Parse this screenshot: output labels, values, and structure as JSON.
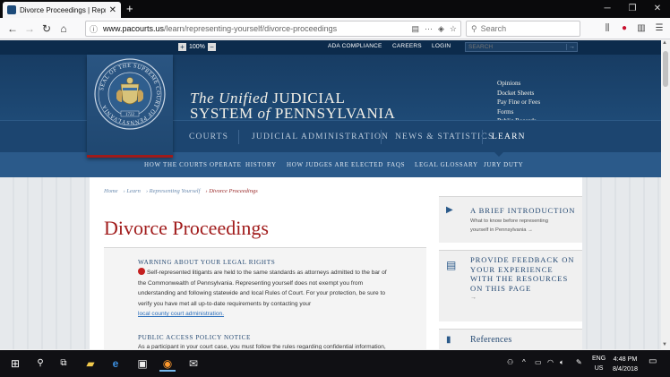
{
  "browser": {
    "tab_title": "Divorce Proceedings | Represe",
    "new_tab": "+",
    "url_prefix": "www.pacourts.us",
    "url_path": "/learn/representing-yourself/divorce-proceedings",
    "search_placeholder": "Search",
    "url_more": "···"
  },
  "top_strip": {
    "zoom_level": "100%",
    "zoom_plus": "+",
    "zoom_minus": "−",
    "links": [
      "ADA COMPLIANCE",
      "CAREERS",
      "LOGIN"
    ],
    "search_placeholder": "SEARCH",
    "search_go": "→"
  },
  "header": {
    "title_line1_italic": "The Unified",
    "title_line1_rest": "JUDICIAL",
    "title_line2_a": "SYSTEM",
    "title_line2_of": "of",
    "title_line2_b": "PENNSYLVANIA",
    "seal_text": "SEAL OF THE SUPREME COURT OF PENNSYLVANIA",
    "seal_year": "1722",
    "quick_links": [
      "Opinions",
      "Docket Sheets",
      "Pay Fine or Fees",
      "Forms",
      "Public Records"
    ]
  },
  "main_nav": [
    "COURTS",
    "JUDICIAL ADMINISTRATION",
    "NEWS & STATISTICS",
    "LEARN"
  ],
  "sub_nav": [
    "HOW THE COURTS OPERATE",
    "HISTORY",
    "HOW JUDGES ARE ELECTED",
    "FAQS",
    "LEGAL GLOSSARY",
    "JURY DUTY"
  ],
  "breadcrumb": [
    "Home",
    "› Learn",
    "› Representing Yourself",
    "› Divorce Proceedings"
  ],
  "page_title": "Divorce Proceedings",
  "sections": {
    "warning_heading": "WARNING ABOUT YOUR LEGAL RIGHTS",
    "warning_lines": [
      "Self-represented litigants are held to the same standards as attorneys admitted to the bar of",
      "the Commonwealth of Pennsylvania. Representing yourself does not exempt you from",
      "understanding and following statewide and local Rules of Court. For your protection, be sure to",
      "verify you have met all up-to-date requirements by contacting your"
    ],
    "warning_link": "local county court administration.",
    "policy_heading": "PUBLIC ACCESS POLICY NOTICE",
    "policy_line": "As a participant in your court case, you must follow the rules regarding confidential information,"
  },
  "sidebar": {
    "card1_title": "A BRIEF INTRODUCTION",
    "card1_desc_1": "What to know before representing",
    "card1_desc_2": "yourself in Pennsylvania →",
    "card2_title": [
      "PROVIDE FEEDBACK ON",
      "YOUR EXPERIENCE",
      "WITH THE RESOURCES",
      "ON THIS PAGE"
    ],
    "card2_arrow": "→",
    "card3_title": "References"
  },
  "taskbar": {
    "lang_1": "ENG",
    "lang_2": "US",
    "time": "4:48 PM",
    "date": "8/4/2018"
  }
}
